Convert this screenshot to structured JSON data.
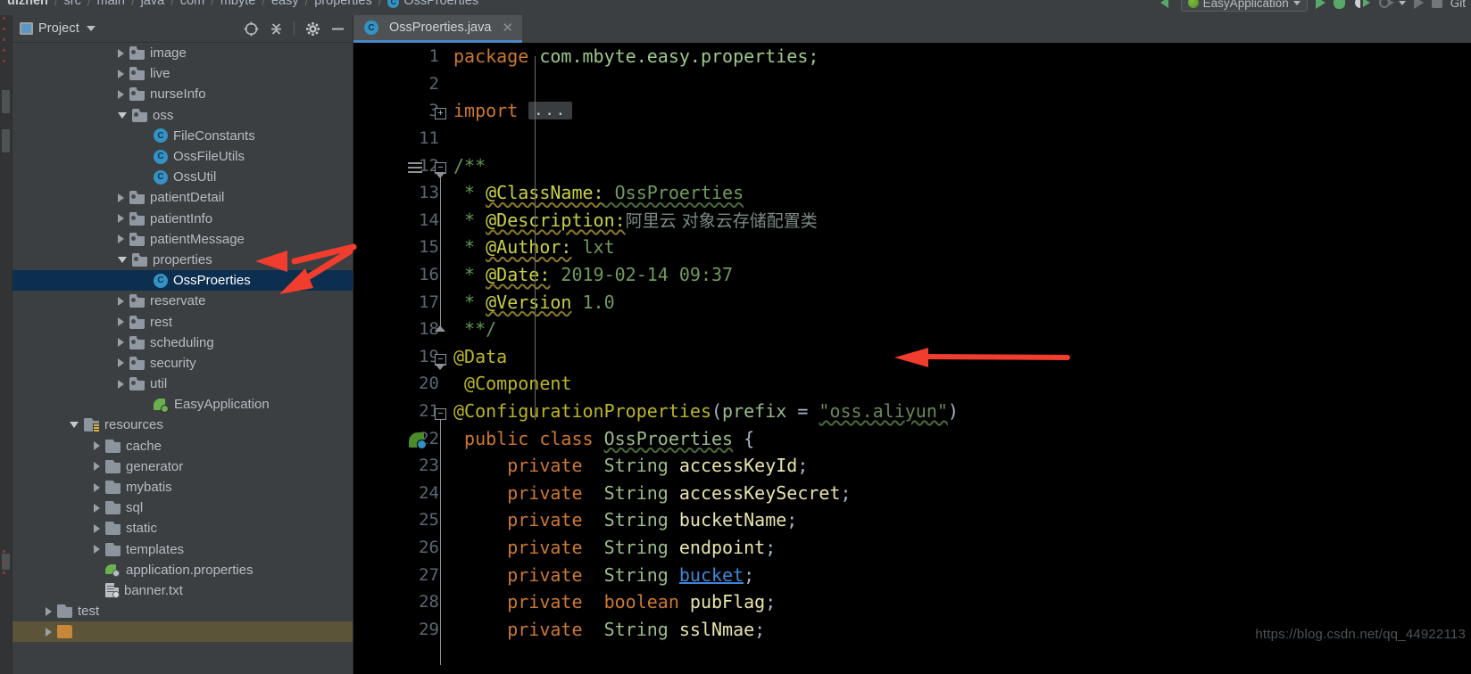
{
  "breadcrumb": {
    "items": [
      "uizhen",
      "src",
      "main",
      "java",
      "com",
      "mbyte",
      "easy",
      "properties"
    ],
    "leaf": "OssProerties",
    "leaf_icon": "java-class-icon",
    "separator": "/"
  },
  "top_toolbar": {
    "run_config_label": "EasyApplication",
    "run_icon": "run-play-icon",
    "debug_icon": "debug-bug-icon",
    "coverage_icon": "run-with-coverage-icon",
    "profile_icon": "profile-icon",
    "rerun_icon": "rerun-icon",
    "stop_icon": "stop-square-icon",
    "vcs_label": "Git"
  },
  "project_panel": {
    "title": "Project",
    "title_icon": "project-window-icon",
    "dropdown_icon": "chevron-down-icon",
    "buttons": [
      {
        "name": "scroll-from-source-icon",
        "glyph": "locate"
      },
      {
        "name": "collapse-all-icon",
        "glyph": "collapse"
      },
      {
        "name": "settings-gear-icon",
        "glyph": "gear"
      },
      {
        "name": "hide-panel-icon",
        "glyph": "minimize"
      }
    ],
    "tree": [
      {
        "label": "image",
        "indent": 4,
        "arrow": "right",
        "icon": "package-icon",
        "state": "normal"
      },
      {
        "label": "live",
        "indent": 4,
        "arrow": "right",
        "icon": "package-icon",
        "state": "normal"
      },
      {
        "label": "nurseInfo",
        "indent": 4,
        "arrow": "right",
        "icon": "package-icon",
        "state": "normal"
      },
      {
        "label": "oss",
        "indent": 4,
        "arrow": "down",
        "icon": "package-icon",
        "state": "normal"
      },
      {
        "label": "FileConstants",
        "indent": 5,
        "arrow": "none",
        "icon": "java-class-icon",
        "state": "normal"
      },
      {
        "label": "OssFileUtils",
        "indent": 5,
        "arrow": "none",
        "icon": "java-class-icon",
        "state": "normal"
      },
      {
        "label": "OssUtil",
        "indent": 5,
        "arrow": "none",
        "icon": "java-class-icon",
        "state": "normal"
      },
      {
        "label": "patientDetail",
        "indent": 4,
        "arrow": "right",
        "icon": "package-icon",
        "state": "normal"
      },
      {
        "label": "patientInfo",
        "indent": 4,
        "arrow": "right",
        "icon": "package-icon",
        "state": "normal"
      },
      {
        "label": "patientMessage",
        "indent": 4,
        "arrow": "right",
        "icon": "package-icon",
        "state": "normal"
      },
      {
        "label": "properties",
        "indent": 4,
        "arrow": "down",
        "icon": "package-icon",
        "state": "normal"
      },
      {
        "label": "OssProerties",
        "indent": 5,
        "arrow": "none",
        "icon": "java-class-icon",
        "state": "selected"
      },
      {
        "label": "reservate",
        "indent": 4,
        "arrow": "right",
        "icon": "package-icon",
        "state": "normal"
      },
      {
        "label": "rest",
        "indent": 4,
        "arrow": "right",
        "icon": "package-icon",
        "state": "normal"
      },
      {
        "label": "scheduling",
        "indent": 4,
        "arrow": "right",
        "icon": "package-icon",
        "state": "normal"
      },
      {
        "label": "security",
        "indent": 4,
        "arrow": "right",
        "icon": "package-icon",
        "state": "normal"
      },
      {
        "label": "util",
        "indent": 4,
        "arrow": "right",
        "icon": "package-icon",
        "state": "normal"
      },
      {
        "label": "EasyApplication",
        "indent": 5,
        "arrow": "none",
        "icon": "spring-boot-app-icon",
        "state": "normal"
      },
      {
        "label": "resources",
        "indent": 2,
        "arrow": "down",
        "icon": "resources-root-icon",
        "state": "normal"
      },
      {
        "label": "cache",
        "indent": 3,
        "arrow": "right",
        "icon": "folder-icon",
        "state": "normal"
      },
      {
        "label": "generator",
        "indent": 3,
        "arrow": "right",
        "icon": "folder-icon",
        "state": "normal"
      },
      {
        "label": "mybatis",
        "indent": 3,
        "arrow": "right",
        "icon": "folder-icon",
        "state": "normal"
      },
      {
        "label": "sql",
        "indent": 3,
        "arrow": "right",
        "icon": "folder-icon",
        "state": "normal"
      },
      {
        "label": "static",
        "indent": 3,
        "arrow": "right",
        "icon": "folder-icon",
        "state": "normal"
      },
      {
        "label": "templates",
        "indent": 3,
        "arrow": "right",
        "icon": "folder-icon",
        "state": "normal"
      },
      {
        "label": "application.properties",
        "indent": 3,
        "arrow": "none",
        "icon": "spring-properties-file-icon",
        "state": "normal"
      },
      {
        "label": "banner.txt",
        "indent": 3,
        "arrow": "none",
        "icon": "text-file-icon",
        "state": "normal"
      },
      {
        "label": "test",
        "indent": 1,
        "arrow": "right",
        "icon": "folder-icon",
        "state": "normal"
      },
      {
        "label": "",
        "indent": 1,
        "arrow": "right",
        "icon": "module-icon",
        "state": "highlight"
      }
    ]
  },
  "editor": {
    "tab": {
      "label": "OssProerties.java",
      "icon": "java-class-icon",
      "close_icon": "close-icon",
      "active": true
    },
    "lines": [
      {
        "num": "1",
        "segments": [
          {
            "t": "package ",
            "c": "kw"
          },
          {
            "t": "com.mbyte.easy.properties;",
            "c": "pkgname"
          }
        ]
      },
      {
        "num": "2",
        "segments": []
      },
      {
        "num": "3",
        "segments": [
          {
            "t": "import ",
            "c": "kw"
          },
          {
            "t": "...",
            "c": "folded"
          }
        ]
      },
      {
        "num": "11",
        "segments": []
      },
      {
        "num": "12",
        "segments": [
          {
            "t": "/**",
            "c": "cmt"
          }
        ]
      },
      {
        "num": "13",
        "segments": [
          {
            "t": " * ",
            "c": "cmt"
          },
          {
            "t": "@ClassName:",
            "c": "jdoc-tag wavy"
          },
          {
            "t": " OssProerties",
            "c": "jdoc-txt wavy-g"
          }
        ]
      },
      {
        "num": "14",
        "segments": [
          {
            "t": " * ",
            "c": "cmt"
          },
          {
            "t": "@Description:",
            "c": "jdoc-tag wavy"
          },
          {
            "t": "阿里云 对象云存储配置类",
            "c": "cjk"
          }
        ]
      },
      {
        "num": "15",
        "segments": [
          {
            "t": " * ",
            "c": "cmt"
          },
          {
            "t": "@Author:",
            "c": "jdoc-tag wavy"
          },
          {
            "t": " lxt",
            "c": "jdoc-txt"
          }
        ]
      },
      {
        "num": "16",
        "segments": [
          {
            "t": " * ",
            "c": "cmt"
          },
          {
            "t": "@Date:",
            "c": "jdoc-tag wavy"
          },
          {
            "t": " 2019-02-14 09:37",
            "c": "jdoc-txt"
          }
        ]
      },
      {
        "num": "17",
        "segments": [
          {
            "t": " * ",
            "c": "cmt"
          },
          {
            "t": "@Version",
            "c": "jdoc-tag wavy"
          },
          {
            "t": " 1.0",
            "c": "jdoc-txt"
          }
        ]
      },
      {
        "num": "18",
        "segments": [
          {
            "t": " **/",
            "c": "cmt"
          }
        ]
      },
      {
        "num": "19",
        "segments": [
          {
            "t": "@Data",
            "c": "anno"
          }
        ]
      },
      {
        "num": "20",
        "segments": [
          {
            "t": " @Component",
            "c": "anno"
          }
        ]
      },
      {
        "num": "21",
        "segments": [
          {
            "t": "@ConfigurationProperties",
            "c": "anno"
          },
          {
            "t": "(",
            "c": "punct"
          },
          {
            "t": "prefix",
            "c": "type"
          },
          {
            "t": " = ",
            "c": "punct"
          },
          {
            "t": "\"oss.aliyun\"",
            "c": "str wavy-g"
          },
          {
            "t": ")",
            "c": "punct"
          }
        ]
      },
      {
        "num": "22",
        "segments": [
          {
            "t": " public class ",
            "c": "kw"
          },
          {
            "t": "OssProerties",
            "c": "type wavy-g"
          },
          {
            "t": " {",
            "c": "punct"
          }
        ]
      },
      {
        "num": "23",
        "segments": [
          {
            "t": "     private ",
            "c": "kw"
          },
          {
            "t": " String ",
            "c": "type"
          },
          {
            "t": "accessKeyId",
            "c": "ident"
          },
          {
            "t": ";",
            "c": "punct"
          }
        ]
      },
      {
        "num": "24",
        "segments": [
          {
            "t": "     private ",
            "c": "kw"
          },
          {
            "t": " String ",
            "c": "type"
          },
          {
            "t": "accessKeySecret",
            "c": "ident"
          },
          {
            "t": ";",
            "c": "punct"
          }
        ]
      },
      {
        "num": "25",
        "segments": [
          {
            "t": "     private ",
            "c": "kw"
          },
          {
            "t": " String ",
            "c": "type"
          },
          {
            "t": "bucketName",
            "c": "ident"
          },
          {
            "t": ";",
            "c": "punct"
          }
        ]
      },
      {
        "num": "26",
        "segments": [
          {
            "t": "     private ",
            "c": "kw"
          },
          {
            "t": " String ",
            "c": "type"
          },
          {
            "t": "endpoint",
            "c": "ident"
          },
          {
            "t": ";",
            "c": "punct"
          }
        ]
      },
      {
        "num": "27",
        "segments": [
          {
            "t": "     private ",
            "c": "kw"
          },
          {
            "t": " String ",
            "c": "type"
          },
          {
            "t": "bucket",
            "c": "link"
          },
          {
            "t": ";",
            "c": "punct"
          }
        ]
      },
      {
        "num": "28",
        "segments": [
          {
            "t": "     private ",
            "c": "kw"
          },
          {
            "t": " boolean ",
            "c": "kw"
          },
          {
            "t": "pubFlag",
            "c": "ident"
          },
          {
            "t": ";",
            "c": "punct"
          }
        ]
      },
      {
        "num": "29",
        "segments": [
          {
            "t": "     private ",
            "c": "kw"
          },
          {
            "t": " String ",
            "c": "type"
          },
          {
            "t": "sslNmae",
            "c": "ident"
          },
          {
            "t": ";",
            "c": "punct"
          }
        ]
      }
    ]
  },
  "annotations": {
    "arrows": [
      {
        "name": "arrow-pointing-properties-folder",
        "color": "#f03d2e"
      },
      {
        "name": "arrow-pointing-ossproerties-file",
        "color": "#f03d2e"
      },
      {
        "name": "arrow-pointing-data-annotation",
        "color": "#f03d2e"
      }
    ]
  },
  "watermark": {
    "text": "https://blog.csdn.net/qq_44922113"
  },
  "colors": {
    "selection_blue": "#0d2f4f",
    "accent_blue": "#3592c4",
    "tab_underline": "#4a88c7",
    "annotation_red": "#f03d2e",
    "editor_bg": "#000000",
    "panel_bg": "#3c3f41"
  }
}
